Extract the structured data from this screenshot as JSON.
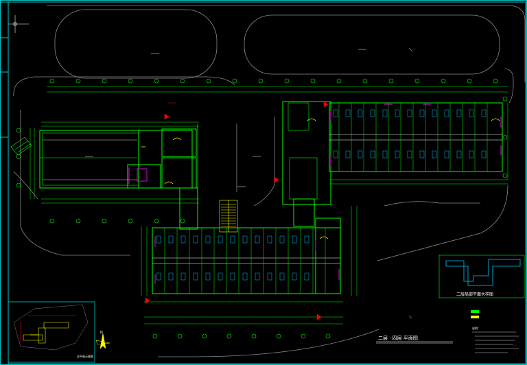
{
  "drawing": {
    "plan_title": "二层 · 四层 平面图",
    "inset_title": "二层局部平面大样图",
    "notes_title": "说明：",
    "keyplan_label": "总平面示意图",
    "north_arrow_label": "N"
  },
  "colors": {
    "background": "#000000",
    "frame": "#00c8c8",
    "wall": "#00ff00",
    "axis": "#ffffff",
    "door": "#ffff00",
    "equipment": "#ff00ff",
    "dimension": "#00ff00",
    "annotation": "#ff0000",
    "road": "#9a9a9a",
    "keyplan_frame": "#00c8c8",
    "stair": "#ffff00"
  },
  "icons": {
    "north_arrow": "north-arrow-icon",
    "section_marker": "section-marker-icon"
  }
}
